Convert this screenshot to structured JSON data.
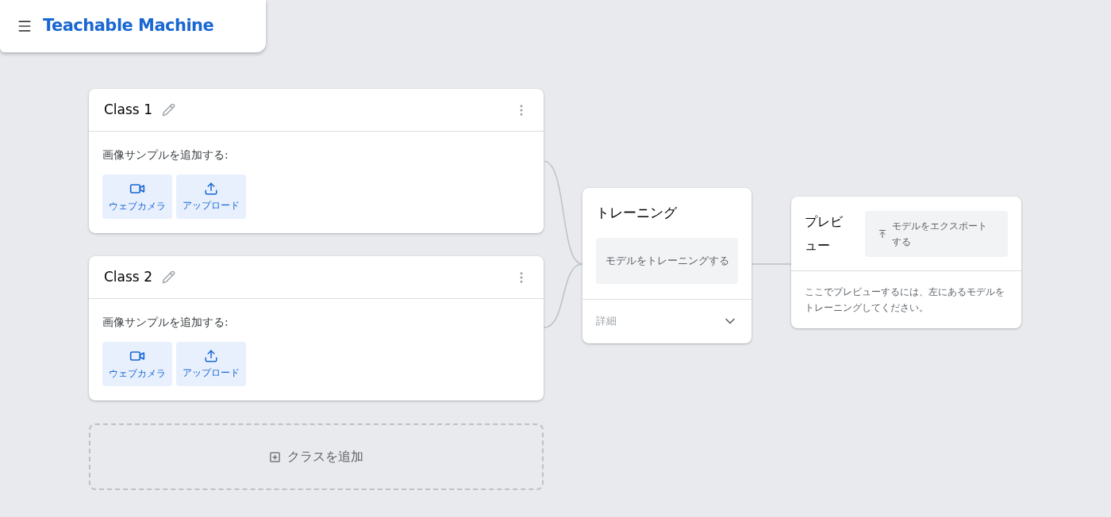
{
  "header": {
    "title": "Teachable Machine"
  },
  "classes": [
    {
      "name": "Class 1",
      "prompt": "画像サンプルを追加する:",
      "buttons": [
        {
          "kind": "webcam",
          "label": "ウェブカメラ"
        },
        {
          "kind": "upload",
          "label": "アップロード"
        }
      ]
    },
    {
      "name": "Class 2",
      "prompt": "画像サンプルを追加する:",
      "buttons": [
        {
          "kind": "webcam",
          "label": "ウェブカメラ"
        },
        {
          "kind": "upload",
          "label": "アップロード"
        }
      ]
    }
  ],
  "add_class": {
    "label": "クラスを追加"
  },
  "training": {
    "title": "トレーニング",
    "button": "モデルをトレーニングする",
    "details": {
      "label": "詳細",
      "expanded": false
    }
  },
  "preview": {
    "title": "プレビュー",
    "export_button": "モデルをエクスポートする",
    "message": "ここでプレビューするには、左にあるモデルをトレーニングしてください。"
  }
}
